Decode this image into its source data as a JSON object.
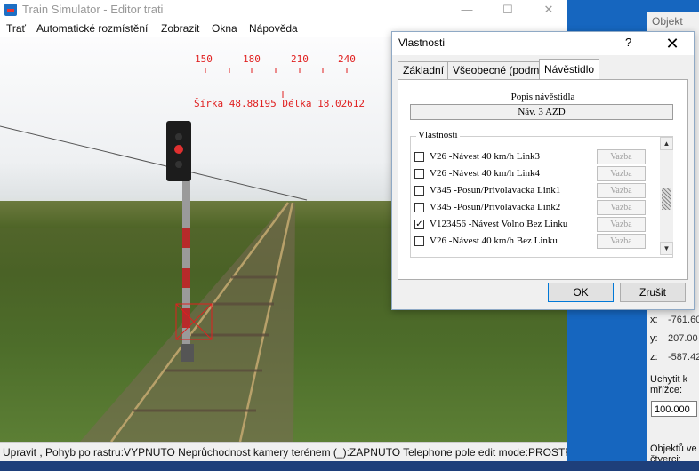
{
  "app": {
    "title": "Train Simulator - Editor trati",
    "min": "—",
    "max": "☐",
    "close": "✕"
  },
  "menu": [
    "Trať",
    "Automatické rozmístění",
    "Zobrazit",
    "Okna",
    "Nápověda"
  ],
  "compass": {
    "ticks": [
      "150",
      "180",
      "210",
      "240"
    ],
    "coords": "Šírka 48.88195 Délka 18.02612",
    "color": "#e02020"
  },
  "status": {
    "text": "Upravit , Pohyb po rastru:VYPNUTO Neprůchodnost kamery terénem (_):ZAPNUTO Telephone pole edit mode:PROSTRED"
  },
  "object_panel": {
    "title": "Objekt",
    "x_label": "x:",
    "x_value": "-761.60",
    "y_label": "y:",
    "y_value": "207.00",
    "z_label": "z:",
    "z_value": "-587.42",
    "snap_label": "Uchytit k mřížce:",
    "snap_value": "100.000",
    "quad_label": "Objektů ve čtverci:"
  },
  "dialog": {
    "title": "Vlastnosti",
    "help": "?",
    "close": "✕",
    "tabs": [
      "Základní",
      "Všeobecné (podm.)",
      "Návěstidlo"
    ],
    "active_tab": "Návěstidlo",
    "desc_label": "Popis návěstidla",
    "desc_value": "Náv. 3 AZD",
    "group_label": "Vlastnosti",
    "link_button": "Vazba",
    "rows": [
      {
        "label": "V26 -Návest 40 km/h Link3",
        "checked": false
      },
      {
        "label": "V26 -Návest 40 km/h Link4",
        "checked": false
      },
      {
        "label": "V345 -Posun/Privolavacka Link1",
        "checked": false
      },
      {
        "label": "V345 -Posun/Privolavacka Link2",
        "checked": false
      },
      {
        "label": "V123456 -Návest Volno Bez Linku",
        "checked": true
      },
      {
        "label": "V26 -Návest 40 km/h Bez Linku",
        "checked": false
      }
    ],
    "ok": "OK",
    "cancel": "Zrušit"
  }
}
